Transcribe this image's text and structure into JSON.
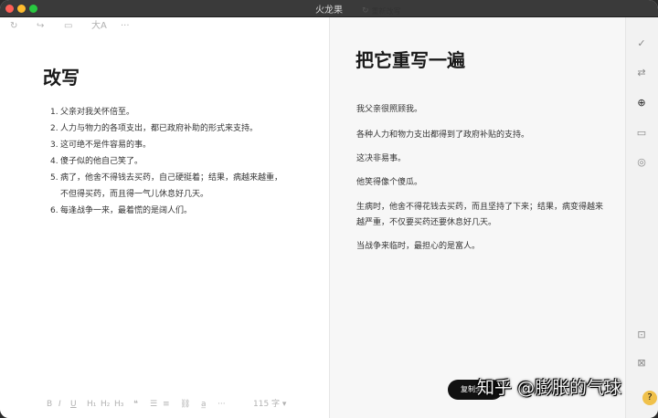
{
  "window": {
    "title": "火龙果"
  },
  "left": {
    "heading": "改写",
    "items": [
      {
        "num": "1.",
        "text": "父亲对我关怀倍至。"
      },
      {
        "num": "2.",
        "text": "人力与物力的各项支出，都已政府补助的形式来支持。"
      },
      {
        "num": "3.",
        "text": "这可绝不是件容易的事。"
      },
      {
        "num": "4.",
        "text": "傻子似的他自己笑了。"
      },
      {
        "num": "5.",
        "text": "病了，他舍不得钱去买药，自己硬挺着；结果，病越来越重，不但得买药，而且得一气儿休息好几天。"
      },
      {
        "num": "6.",
        "text": "每逢战争一来，最着慌的是阔人们。"
      }
    ],
    "toolbar": {
      "refresh_icon": "↻",
      "share_icon": "↪",
      "image_icon": "▭",
      "font_icon": "大A",
      "more_icon": "···"
    },
    "format_bar": {
      "bold": "B",
      "italic": "I",
      "underline": "U",
      "h1": "H₁",
      "h2": "H₂",
      "h3": "H₃",
      "quote": "❝",
      "list": "☰",
      "olist": "≡",
      "link": "⛓",
      "clear": "a̲",
      "more": "···",
      "wordcount": "115 字 ▾"
    }
  },
  "right": {
    "regen_label": "重新改写",
    "heading": "把它重写一遍",
    "paragraphs": [
      "我父亲很照顾我。",
      "各种人力和物力支出都得到了政府补贴的支持。",
      "这决非易事。",
      "他笑得像个傻瓜。",
      "生病时，他舍不得花钱去买药，而且坚持了下来；结果，病变得越来越严重，不仅要买药还要休息好几天。",
      "当战争来临时，最担心的是富人。"
    ],
    "copy_label": "复制全文",
    "watermark": "知乎 @膨胀的气球"
  },
  "sidebar": {
    "icons": [
      "✓",
      "⇄",
      "⊕",
      "▭",
      "◎",
      "⊡",
      "⊠"
    ],
    "icon_names": [
      "check-icon",
      "translate-icon",
      "rewrite-icon",
      "briefcase-icon",
      "compass-icon",
      "document-search-icon",
      "document-icon"
    ],
    "badge": "?"
  }
}
